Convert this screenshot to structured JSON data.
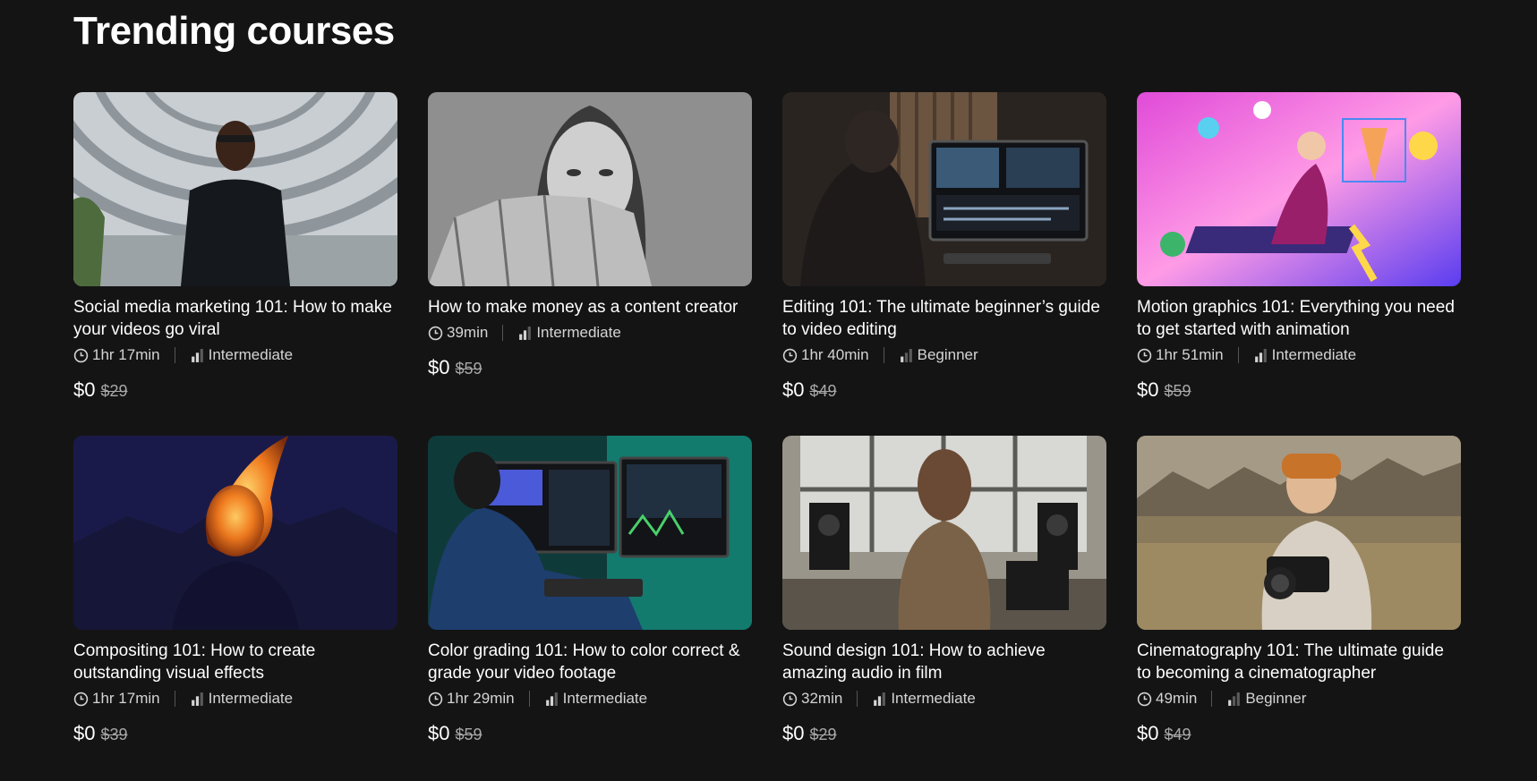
{
  "section": {
    "title": "Trending courses"
  },
  "courses": [
    {
      "title": "Social media marketing 101: How to make your videos go viral",
      "duration": "1hr 17min",
      "level": "Intermediate",
      "price": "$0",
      "original_price": "$29"
    },
    {
      "title": "How to make money as a content creator",
      "duration": "39min",
      "level": "Intermediate",
      "price": "$0",
      "original_price": "$59"
    },
    {
      "title": "Editing 101: The ultimate beginner’s guide to video editing",
      "duration": "1hr 40min",
      "level": "Beginner",
      "price": "$0",
      "original_price": "$49"
    },
    {
      "title": "Motion graphics 101: Everything you need to get started with animation",
      "duration": "1hr 51min",
      "level": "Intermediate",
      "price": "$0",
      "original_price": "$59"
    },
    {
      "title": "Compositing 101: How to create outstanding visual effects",
      "duration": "1hr 17min",
      "level": "Intermediate",
      "price": "$0",
      "original_price": "$39"
    },
    {
      "title": "Color grading 101: How to color correct & grade your video footage",
      "duration": "1hr 29min",
      "level": "Intermediate",
      "price": "$0",
      "original_price": "$59"
    },
    {
      "title": "Sound design 101: How to achieve amazing audio in film",
      "duration": "32min",
      "level": "Intermediate",
      "price": "$0",
      "original_price": "$29"
    },
    {
      "title": "Cinematography 101: The ultimate guide to becoming a cinematographer",
      "duration": "49min",
      "level": "Beginner",
      "price": "$0",
      "original_price": "$49"
    }
  ],
  "icons": {
    "duration": "clock-icon",
    "level": "level-bars-icon"
  },
  "colors": {
    "background": "#141414",
    "text": "#ffffff",
    "muted": "#a8a8a8"
  }
}
